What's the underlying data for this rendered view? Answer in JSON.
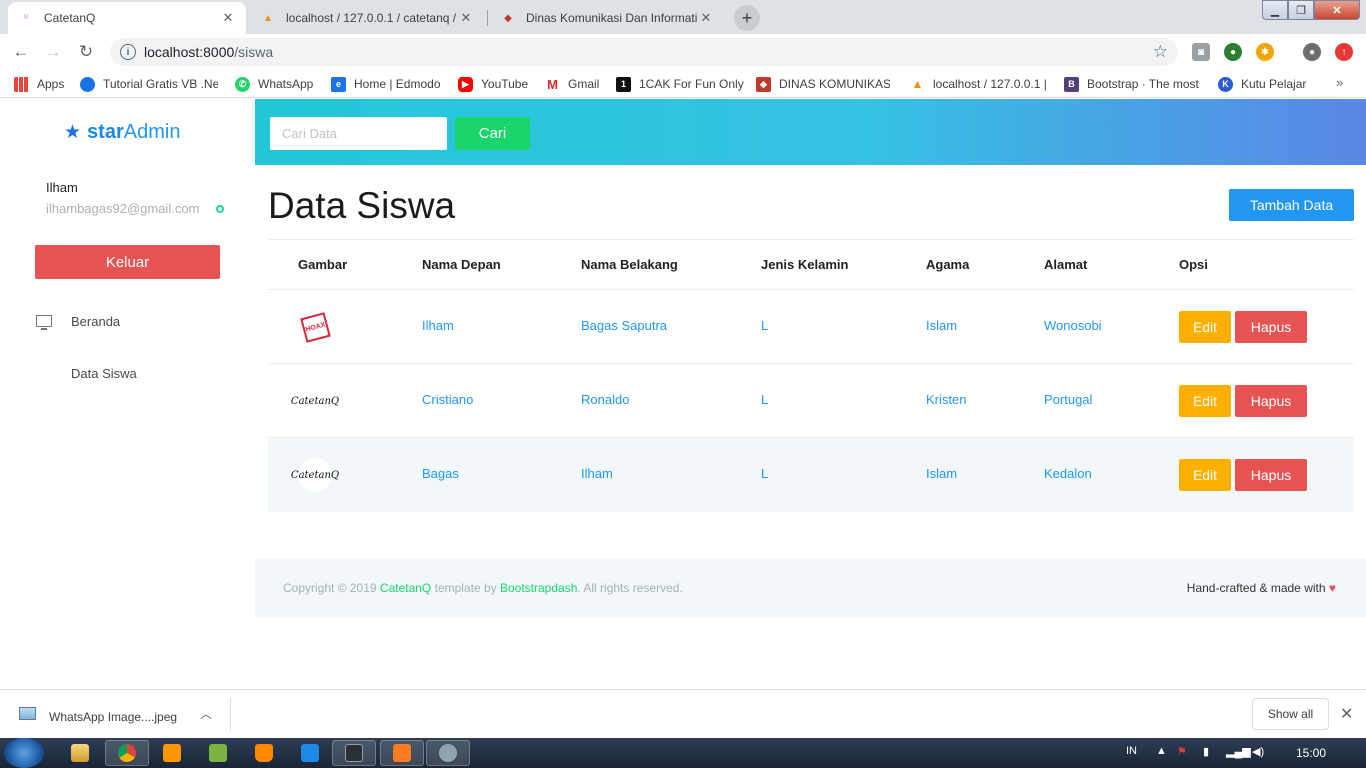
{
  "browser": {
    "tabs": [
      {
        "title": "CatetanQ",
        "favicon": "catetanq-icon",
        "active": true
      },
      {
        "title": "localhost / 127.0.0.1 / catetanq /",
        "favicon": "phpmyadmin-icon",
        "active": false
      },
      {
        "title": "Dinas Komunikasi Dan Informatik",
        "favicon": "dinas-icon",
        "active": false
      }
    ],
    "url_host": "localhost:8000",
    "url_path": "/siswa",
    "bookmarks": [
      {
        "label": "Apps",
        "icon": "apps-grid-icon",
        "color": "#e8453c"
      },
      {
        "label": "Tutorial Gratis VB .Ne",
        "icon": "tutorial-icon",
        "color": "#1a73e8"
      },
      {
        "label": "WhatsApp",
        "icon": "whatsapp-icon",
        "color": "#25d366"
      },
      {
        "label": "Home | Edmodo",
        "icon": "edmodo-icon",
        "color": "#1a73e8"
      },
      {
        "label": "YouTube",
        "icon": "youtube-icon",
        "color": "#ff0000"
      },
      {
        "label": "Gmail",
        "icon": "gmail-icon",
        "color": "#d93025"
      },
      {
        "label": "1CAK For Fun Only",
        "icon": "1cak-icon",
        "color": "#111111"
      },
      {
        "label": "DINAS KOMUNIKASI",
        "icon": "dinas-icon",
        "color": "#c0392b"
      },
      {
        "label": "localhost / 127.0.0.1 |",
        "icon": "phpmyadmin-icon",
        "color": "#f29111"
      },
      {
        "label": "Bootstrap · The most",
        "icon": "bootstrap-icon",
        "color": "#563d7c"
      },
      {
        "label": "Kutu Pelajar",
        "icon": "kutu-pelajar-icon",
        "color": "#2a5bd7"
      }
    ],
    "bookmarks_more": "»"
  },
  "app": {
    "brand_prefix": "star",
    "brand_suffix": "Admin",
    "user_name": "Ilham",
    "user_email": "ilhambagas92@gmail.com",
    "logout_label": "Keluar",
    "nav": [
      {
        "label": "Beranda",
        "icon": "monitor-icon"
      },
      {
        "label": "Data Siswa",
        "icon": ""
      }
    ],
    "search": {
      "placeholder": "Cari Data",
      "value": "",
      "button": "Cari"
    },
    "page_title": "Data Siswa",
    "add_button": "Tambah Data",
    "table": {
      "headers": [
        "Gambar",
        "Nama Depan",
        "Nama Belakang",
        "Jenis Kelamin",
        "Agama",
        "Alamat",
        "Opsi"
      ],
      "rows": [
        {
          "image": "hoax-logo",
          "image_text": "HOAX",
          "first": "Ilham",
          "last": "Bagas Saputra",
          "gender": "L",
          "religion": "Islam",
          "address": "Wonosobi"
        },
        {
          "image": "catetanq-logo",
          "image_text": "CatetanQ",
          "first": "Cristiano",
          "last": "Ronaldo",
          "gender": "L",
          "religion": "Kristen",
          "address": "Portugal"
        },
        {
          "image": "catetanq-logo-circle",
          "image_text": "CatetanQ",
          "first": "Bagas",
          "last": "Ilham",
          "gender": "L",
          "religion": "Islam",
          "address": "Kedalon"
        }
      ],
      "edit_label": "Edit",
      "delete_label": "Hapus"
    },
    "footer": {
      "copyright_pre": "Copyright © 2019 ",
      "brand_link": "CatetanQ",
      "template_by": " template by ",
      "author_link": "Bootstrapdash",
      "rights": ". All rights reserved.",
      "right_text": "Hand-crafted & made with",
      "heart": "♥"
    }
  },
  "downloads": {
    "file_name": "WhatsApp Image....jpeg",
    "show_all": "Show all"
  },
  "taskbar": {
    "language": "IN",
    "clock": "15:00"
  },
  "colors": {
    "accent_blue": "#2196f3",
    "success_green": "#19d56a",
    "danger_red": "#e75353",
    "warning_orange": "#ffaf00"
  }
}
